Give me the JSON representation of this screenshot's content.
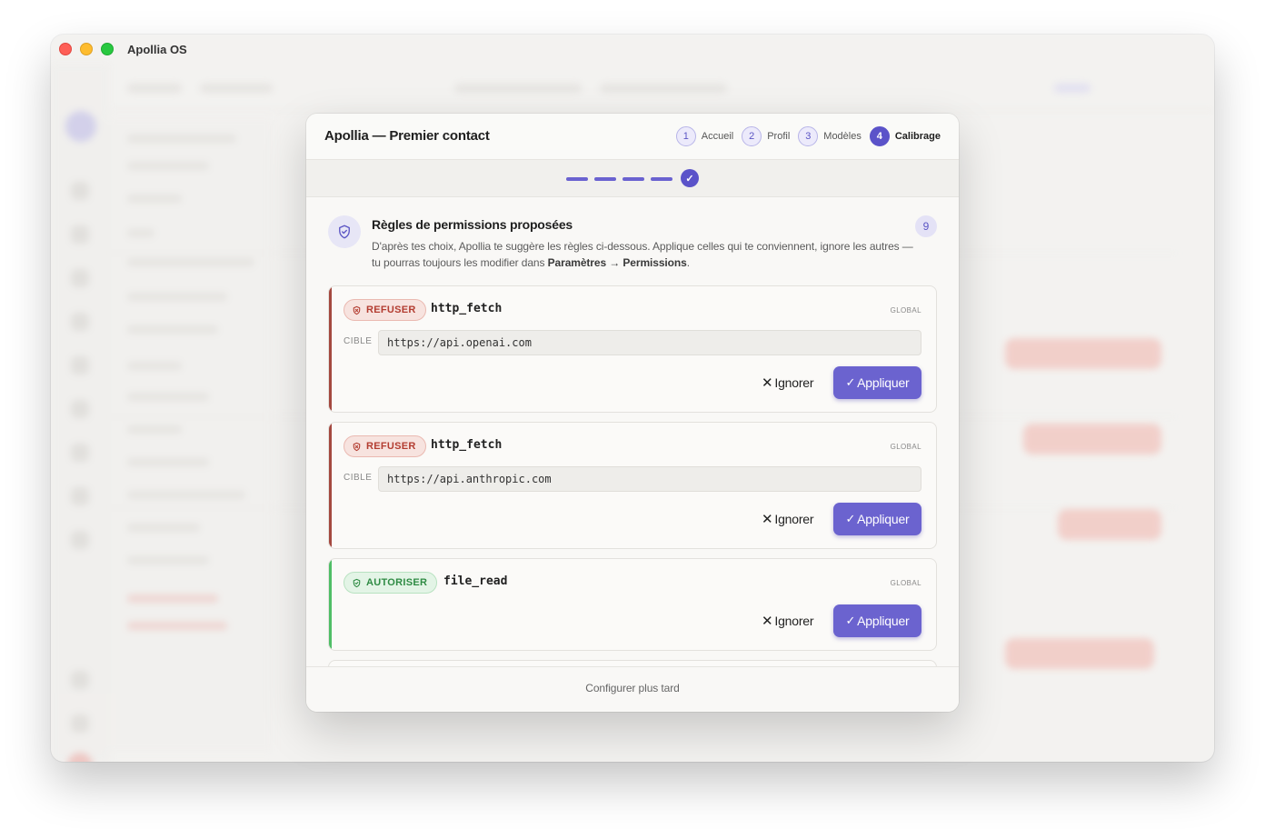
{
  "window": {
    "title": "Apollia OS"
  },
  "modal": {
    "title": "Apollia — Premier contact",
    "steps": [
      {
        "num": "1",
        "label": "Accueil",
        "active": false
      },
      {
        "num": "2",
        "label": "Profil",
        "active": false
      },
      {
        "num": "3",
        "label": "Modèles",
        "active": false
      },
      {
        "num": "4",
        "label": "Calibrage",
        "active": true
      }
    ],
    "progress_check": "✓",
    "intro": {
      "title": "Règles de permissions proposées",
      "count": "9",
      "text_before": "D'après tes choix, Apollia te suggère les règles ci-dessous. Applique celles qui te conviennent, ignore les autres — tu pourras toujours les modifier dans ",
      "link_settings": "Paramètres",
      "arrow": "→",
      "link_permissions": "Permissions",
      "text_after": "."
    },
    "rules": [
      {
        "action": "REFUSER",
        "kind": "deny",
        "tool": "http_fetch",
        "scope": "GLOBAL",
        "target_label": "CIBLE",
        "target": "https://api.openai.com",
        "ignore_label": "Ignorer",
        "apply_label": "Appliquer"
      },
      {
        "action": "REFUSER",
        "kind": "deny",
        "tool": "http_fetch",
        "scope": "GLOBAL",
        "target_label": "CIBLE",
        "target": "https://api.anthropic.com",
        "ignore_label": "Ignorer",
        "apply_label": "Appliquer"
      },
      {
        "action": "AUTORISER",
        "kind": "allow",
        "tool": "file_read",
        "scope": "GLOBAL",
        "ignore_label": "Ignorer",
        "apply_label": "Appliquer"
      }
    ],
    "footer": {
      "later_label": "Configurer plus tard"
    }
  },
  "colors": {
    "accent": "#5b53c9",
    "deny": "#b33d31",
    "allow": "#2f8b44"
  },
  "icons": {
    "shield": "shield-check-icon",
    "deny_badge": "shield-x-icon",
    "allow_badge": "shield-check-icon",
    "ignore": "close-icon",
    "apply": "check-icon"
  }
}
